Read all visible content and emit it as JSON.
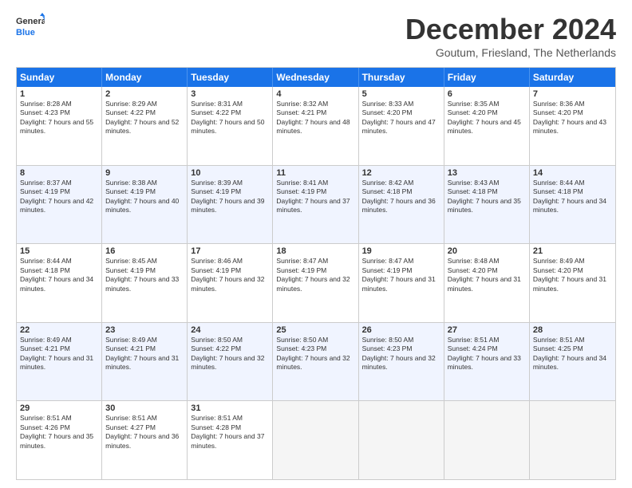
{
  "logo": {
    "line1": "General",
    "line2": "Blue"
  },
  "title": "December 2024",
  "location": "Goutum, Friesland, The Netherlands",
  "days": [
    "Sunday",
    "Monday",
    "Tuesday",
    "Wednesday",
    "Thursday",
    "Friday",
    "Saturday"
  ],
  "weeks": [
    [
      {
        "day": "1",
        "rise": "8:28 AM",
        "set": "4:23 PM",
        "daylight": "7 hours and 55 minutes."
      },
      {
        "day": "2",
        "rise": "8:29 AM",
        "set": "4:22 PM",
        "daylight": "7 hours and 52 minutes."
      },
      {
        "day": "3",
        "rise": "8:31 AM",
        "set": "4:22 PM",
        "daylight": "7 hours and 50 minutes."
      },
      {
        "day": "4",
        "rise": "8:32 AM",
        "set": "4:21 PM",
        "daylight": "7 hours and 48 minutes."
      },
      {
        "day": "5",
        "rise": "8:33 AM",
        "set": "4:20 PM",
        "daylight": "7 hours and 47 minutes."
      },
      {
        "day": "6",
        "rise": "8:35 AM",
        "set": "4:20 PM",
        "daylight": "7 hours and 45 minutes."
      },
      {
        "day": "7",
        "rise": "8:36 AM",
        "set": "4:20 PM",
        "daylight": "7 hours and 43 minutes."
      }
    ],
    [
      {
        "day": "8",
        "rise": "8:37 AM",
        "set": "4:19 PM",
        "daylight": "7 hours and 42 minutes."
      },
      {
        "day": "9",
        "rise": "8:38 AM",
        "set": "4:19 PM",
        "daylight": "7 hours and 40 minutes."
      },
      {
        "day": "10",
        "rise": "8:39 AM",
        "set": "4:19 PM",
        "daylight": "7 hours and 39 minutes."
      },
      {
        "day": "11",
        "rise": "8:41 AM",
        "set": "4:19 PM",
        "daylight": "7 hours and 37 minutes."
      },
      {
        "day": "12",
        "rise": "8:42 AM",
        "set": "4:18 PM",
        "daylight": "7 hours and 36 minutes."
      },
      {
        "day": "13",
        "rise": "8:43 AM",
        "set": "4:18 PM",
        "daylight": "7 hours and 35 minutes."
      },
      {
        "day": "14",
        "rise": "8:44 AM",
        "set": "4:18 PM",
        "daylight": "7 hours and 34 minutes."
      }
    ],
    [
      {
        "day": "15",
        "rise": "8:44 AM",
        "set": "4:18 PM",
        "daylight": "7 hours and 34 minutes."
      },
      {
        "day": "16",
        "rise": "8:45 AM",
        "set": "4:19 PM",
        "daylight": "7 hours and 33 minutes."
      },
      {
        "day": "17",
        "rise": "8:46 AM",
        "set": "4:19 PM",
        "daylight": "7 hours and 32 minutes."
      },
      {
        "day": "18",
        "rise": "8:47 AM",
        "set": "4:19 PM",
        "daylight": "7 hours and 32 minutes."
      },
      {
        "day": "19",
        "rise": "8:47 AM",
        "set": "4:19 PM",
        "daylight": "7 hours and 31 minutes."
      },
      {
        "day": "20",
        "rise": "8:48 AM",
        "set": "4:20 PM",
        "daylight": "7 hours and 31 minutes."
      },
      {
        "day": "21",
        "rise": "8:49 AM",
        "set": "4:20 PM",
        "daylight": "7 hours and 31 minutes."
      }
    ],
    [
      {
        "day": "22",
        "rise": "8:49 AM",
        "set": "4:21 PM",
        "daylight": "7 hours and 31 minutes."
      },
      {
        "day": "23",
        "rise": "8:49 AM",
        "set": "4:21 PM",
        "daylight": "7 hours and 31 minutes."
      },
      {
        "day": "24",
        "rise": "8:50 AM",
        "set": "4:22 PM",
        "daylight": "7 hours and 32 minutes."
      },
      {
        "day": "25",
        "rise": "8:50 AM",
        "set": "4:23 PM",
        "daylight": "7 hours and 32 minutes."
      },
      {
        "day": "26",
        "rise": "8:50 AM",
        "set": "4:23 PM",
        "daylight": "7 hours and 32 minutes."
      },
      {
        "day": "27",
        "rise": "8:51 AM",
        "set": "4:24 PM",
        "daylight": "7 hours and 33 minutes."
      },
      {
        "day": "28",
        "rise": "8:51 AM",
        "set": "4:25 PM",
        "daylight": "7 hours and 34 minutes."
      }
    ],
    [
      {
        "day": "29",
        "rise": "8:51 AM",
        "set": "4:26 PM",
        "daylight": "7 hours and 35 minutes."
      },
      {
        "day": "30",
        "rise": "8:51 AM",
        "set": "4:27 PM",
        "daylight": "7 hours and 36 minutes."
      },
      {
        "day": "31",
        "rise": "8:51 AM",
        "set": "4:28 PM",
        "daylight": "7 hours and 37 minutes."
      },
      null,
      null,
      null,
      null
    ]
  ]
}
